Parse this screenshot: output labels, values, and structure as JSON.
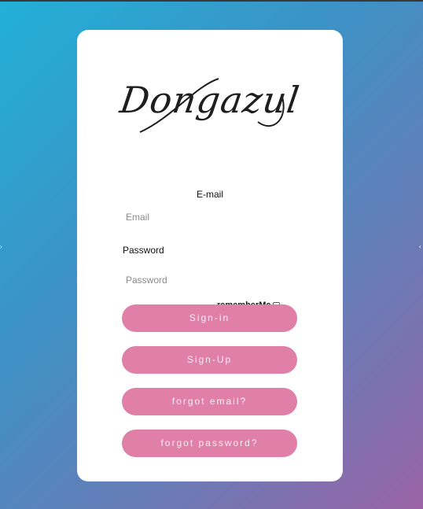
{
  "colors": {
    "background_start": "#21b0d8",
    "background_end": "#9a63a6",
    "card": "#ffffff",
    "button": "#e07fa7",
    "button_text": "#fbeef3"
  },
  "brand": {
    "logo_text": "Dongazul"
  },
  "form": {
    "email_label": "E-mail",
    "email_placeholder": "Email",
    "password_label": "Password",
    "password_placeholder": "Password",
    "remember_label": "rememberMe",
    "remember_checked": false
  },
  "buttons": {
    "signin": "Sign-in",
    "signup": "Sign-Up",
    "forgot_email": "forgot email?",
    "forgot_password": "forgot password?"
  }
}
